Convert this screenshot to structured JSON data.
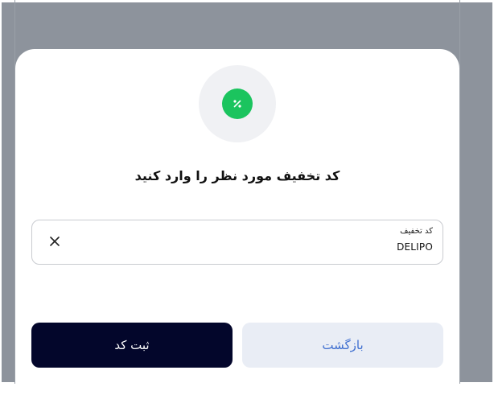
{
  "modal": {
    "title": "کد تخفیف مورد نظر را وارد کنید",
    "icon": "percent-icon",
    "accent_color": "#1bc45e"
  },
  "discount_field": {
    "label": "کد تخفیف",
    "value": "DELIPO",
    "clear_icon": "close-icon"
  },
  "actions": {
    "submit_label": "ثبت کد",
    "back_label": "بازگشت",
    "submit_color": "#03062b",
    "back_color": "#e9edf5"
  }
}
